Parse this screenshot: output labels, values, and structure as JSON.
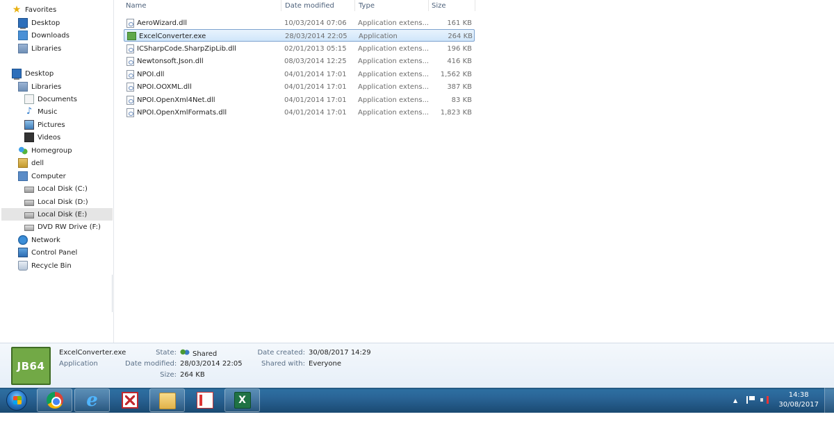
{
  "nav": {
    "favorites": "Favorites",
    "fav_desktop": "Desktop",
    "fav_downloads": "Downloads",
    "fav_libraries": "Libraries",
    "desktop": "Desktop",
    "libraries": "Libraries",
    "documents": "Documents",
    "music": "Music",
    "pictures": "Pictures",
    "videos": "Videos",
    "homegroup": "Homegroup",
    "user": "dell",
    "computer": "Computer",
    "disk_c": "Local Disk (C:)",
    "disk_d": "Local Disk (D:)",
    "disk_e": "Local Disk (E:)",
    "dvd_f": "DVD RW Drive (F:)",
    "network": "Network",
    "control_panel": "Control Panel",
    "recycle_bin": "Recycle Bin"
  },
  "columns": {
    "name": "Name",
    "date_modified": "Date modified",
    "type": "Type",
    "size": "Size"
  },
  "files": [
    {
      "name": "AeroWizard.dll",
      "date": "10/03/2014 07:06",
      "type": "Application extens...",
      "size": "161 KB"
    },
    {
      "name": "ExcelConverter.exe",
      "date": "28/03/2014 22:05",
      "type": "Application",
      "size": "264 KB"
    },
    {
      "name": "ICSharpCode.SharpZipLib.dll",
      "date": "02/01/2013 05:15",
      "type": "Application extens...",
      "size": "196 KB"
    },
    {
      "name": "Newtonsoft.Json.dll",
      "date": "08/03/2014 12:25",
      "type": "Application extens...",
      "size": "416 KB"
    },
    {
      "name": "NPOI.dll",
      "date": "04/01/2014 17:01",
      "type": "Application extens...",
      "size": "1,562 KB"
    },
    {
      "name": "NPOI.OOXML.dll",
      "date": "04/01/2014 17:01",
      "type": "Application extens...",
      "size": "387 KB"
    },
    {
      "name": "NPOI.OpenXml4Net.dll",
      "date": "04/01/2014 17:01",
      "type": "Application extens...",
      "size": "83 KB"
    },
    {
      "name": "NPOI.OpenXmlFormats.dll",
      "date": "04/01/2014 17:01",
      "type": "Application extens...",
      "size": "1,823 KB"
    }
  ],
  "details": {
    "icon_text": "JB64",
    "filename": "ExcelConverter.exe",
    "filetype": "Application",
    "state_label": "State:",
    "state_value": "Shared",
    "date_modified_label": "Date modified:",
    "date_modified_value": "28/03/2014 22:05",
    "size_label": "Size:",
    "size_value": "264 KB",
    "date_created_label": "Date created:",
    "date_created_value": "30/08/2017 14:29",
    "shared_with_label": "Shared with:",
    "shared_with_value": "Everyone"
  },
  "taskbar": {
    "apps": [
      "chrome-icon",
      "internet-explorer-icon",
      "foxit-reader-icon",
      "file-explorer-icon",
      "book-app-icon",
      "excel-icon"
    ],
    "ie_glyph": "e",
    "excel_glyph": "X",
    "tray_arrow": "▲",
    "clock_time": "14:38",
    "clock_date": "30/08/2017"
  },
  "colors": {
    "selection": "#d0e6fa",
    "taskbar": "#2a6496",
    "exe_icon": "#72a946"
  }
}
